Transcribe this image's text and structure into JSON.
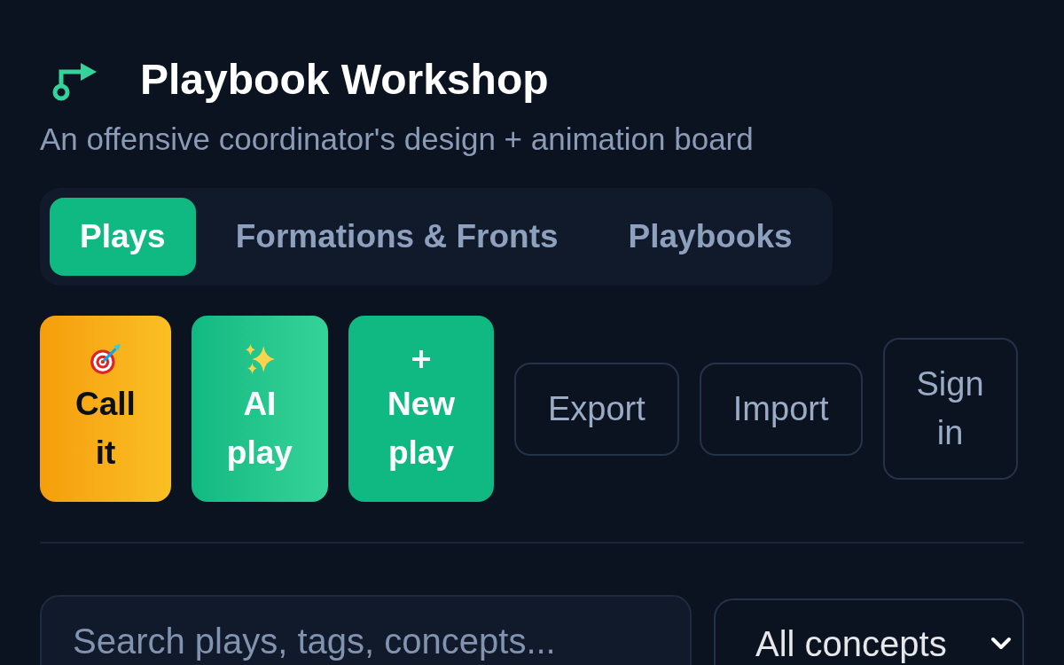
{
  "header": {
    "title": "Playbook Workshop",
    "subtitle": "An offensive coordinator's design + animation board"
  },
  "tabs": [
    {
      "label": "Plays",
      "selected": true
    },
    {
      "label": "Formations & Fronts",
      "selected": false
    },
    {
      "label": "Playbooks",
      "selected": false
    }
  ],
  "actions": [
    {
      "kind": "call",
      "label": "Call it"
    },
    {
      "kind": "ai",
      "label": "AI play"
    },
    {
      "kind": "new",
      "label": "New play"
    },
    {
      "kind": "outline",
      "label": "Export"
    },
    {
      "kind": "outline",
      "label": "Import"
    },
    {
      "kind": "outline",
      "label": "Sign in"
    }
  ],
  "filters": {
    "search": {
      "placeholder": "Search plays, tags, concepts..."
    },
    "concept_select": {
      "value": "All concepts"
    }
  }
}
